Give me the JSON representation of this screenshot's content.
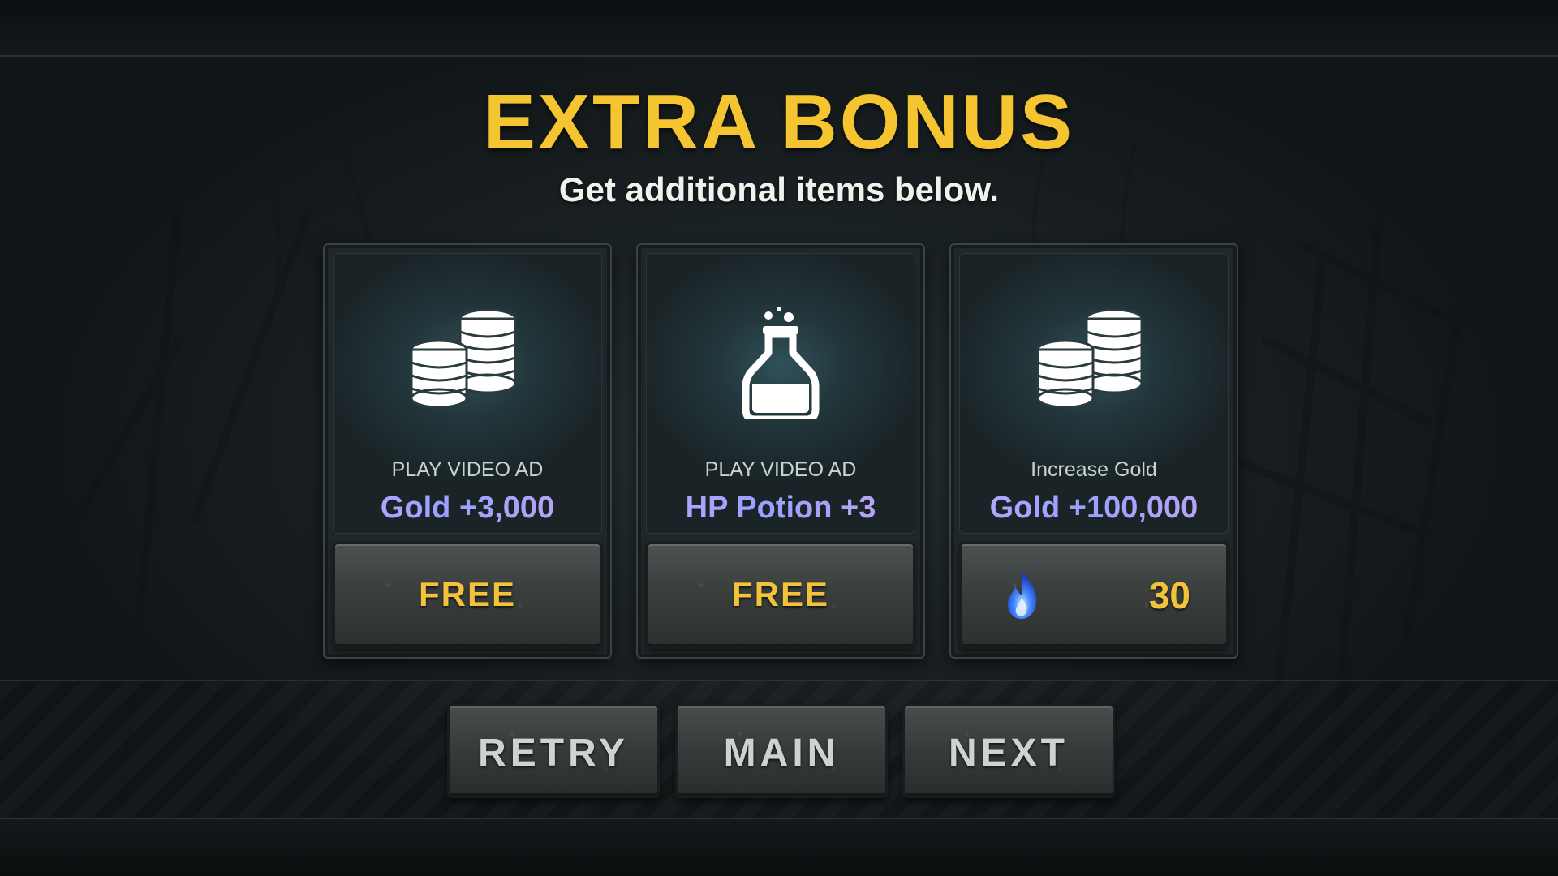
{
  "header": {
    "title": "EXTRA BONUS",
    "subtitle": "Get additional items below."
  },
  "cards": [
    {
      "icon": "gold-coins-icon",
      "caption": "PLAY VIDEO AD",
      "reward": "Gold +3,000",
      "button_label": "FREE"
    },
    {
      "icon": "hp-potion-icon",
      "caption": "PLAY VIDEO AD",
      "reward": "HP Potion +3",
      "button_label": "FREE"
    },
    {
      "icon": "gold-coins-icon",
      "caption": "Increase Gold",
      "reward": "Gold +100,000",
      "cost_icon": "blue-flame-icon",
      "cost_value": "30"
    }
  ],
  "nav": {
    "retry_label": "RETRY",
    "main_label": "MAIN",
    "next_label": "NEXT"
  },
  "colors": {
    "title": "#f5c431",
    "button_text": "#f3c23a",
    "reward_gradient_start": "#b9a7ff",
    "reward_gradient_end": "#c0a6f2"
  }
}
